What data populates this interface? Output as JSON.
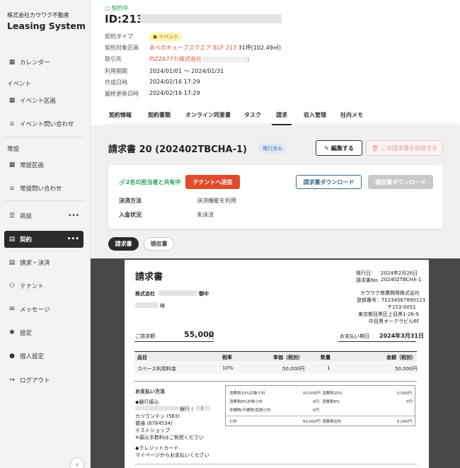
{
  "sidebar": {
    "company": "株式会社カウワク不動産",
    "system": "Leasing System",
    "items": [
      {
        "label": "カレンダー"
      },
      {
        "label": "イベント"
      },
      {
        "label": "イベント区画"
      },
      {
        "label": "イベント問い合わせ"
      },
      {
        "label": "常設"
      },
      {
        "label": "常設区画"
      },
      {
        "label": "常設問い合わせ"
      },
      {
        "label": "商談"
      },
      {
        "label": "契約"
      },
      {
        "label": "請求・決済"
      },
      {
        "label": "テナント"
      },
      {
        "label": "メッセージ"
      },
      {
        "label": "設定"
      },
      {
        "label": "個人設定"
      },
      {
        "label": "ログアウト"
      }
    ],
    "more": "•••"
  },
  "header": {
    "status": "契約中",
    "id": "ID:213",
    "meta": [
      {
        "key": "契約タイプ",
        "value": "イベント"
      },
      {
        "key": "契約対象区画",
        "value": "あべのキューブスクエア B1F 213",
        "extra": "31坪(102.49㎡)"
      },
      {
        "key": "取引先",
        "value": "PIZZA777(株式会社",
        "suffix": ")"
      },
      {
        "key": "利用期間",
        "value": "2024/01/01 〜 2024/01/31"
      },
      {
        "key": "作成日時",
        "value": "2024/02/16 17:29"
      },
      {
        "key": "最終更新日時",
        "value": "2024/02/16 17:29"
      }
    ]
  },
  "tabs": [
    "契約情報",
    "契約書類",
    "オンライン同意書",
    "タスク",
    "請求",
    "収入管理",
    "社内メモ"
  ],
  "invoice": {
    "title": "請求書 20 (202402TBCHA-1)",
    "status_badge": "発行済み",
    "edit_label": "編集する",
    "delete_label": "この請求書を削除する",
    "shared_text": "2名の担当者と共有中",
    "send_label": "テナントへ送信",
    "download_invoice_label": "請求書ダウンロード",
    "download_receipt_label": "領収書ダウンロード",
    "payment_method_key": "決済方法",
    "payment_method_value": "決済機能を利用",
    "payment_status_key": "入金状況",
    "payment_status_value": "未決済",
    "pill_invoice": "請求書",
    "pill_receipt": "領収書"
  },
  "document": {
    "title": "請求書",
    "issue_date_label": "発行日：",
    "issue_date": "2024年2月26日",
    "invoice_no_label": "請求書No.",
    "invoice_no": "202402TBCHA-1",
    "recipient_co": "株式会社",
    "recipient_honorific": "御中",
    "recipient_person_honorific": "様",
    "issuer_name": "カウワク商業開発株式会社",
    "issuer_reg": "登録番号：T1234567890123",
    "issuer_zip": "〒153-0051",
    "issuer_addr1": "東京都目黒区上目黒1-26-9",
    "issuer_addr2": "中目黒オークラビル6F",
    "amount_label": "ご請求額",
    "amount_value": "55,000",
    "amount_unit": "円",
    "due_label": "お支払い期日",
    "due_value": "2024年3月31日",
    "table_headers": [
      "品目",
      "税率",
      "単価（税別）",
      "数量",
      "金額（税別）"
    ],
    "table_rows": [
      [
        "スペース利用料金",
        "10%",
        "50,000円",
        "1",
        "50,000円"
      ]
    ],
    "payment_heading": "お支払い方法",
    "bank_heading": "◆銀行振込",
    "bank_suffix": "銀行 (",
    "bank_close": ")",
    "bank_branch": "カツウンテン (583)",
    "bank_account": "普通 (8784534)",
    "bank_holder": "テストショップ",
    "bank_note": "※振込手数料はご負担ください",
    "card_heading": "◆クレジットカード",
    "card_note": "マイページからお支払いください",
    "tax_rows": [
      [
        "消費税10%対象小計",
        "50,000円",
        "消費税10%",
        "5,000円"
      ],
      [
        "消費税8%対象小計",
        "0円",
        "消費税8%",
        "0円"
      ],
      [
        "非課税/不課税/免税小計",
        "0円",
        "",
        ""
      ],
      [
        "小計",
        "50,000円",
        "消費税合計",
        "5,000円"
      ]
    ]
  },
  "colors": {
    "accent_red": "#e24a2d",
    "green": "#1f9d55",
    "dark": "#2b2b2b"
  }
}
